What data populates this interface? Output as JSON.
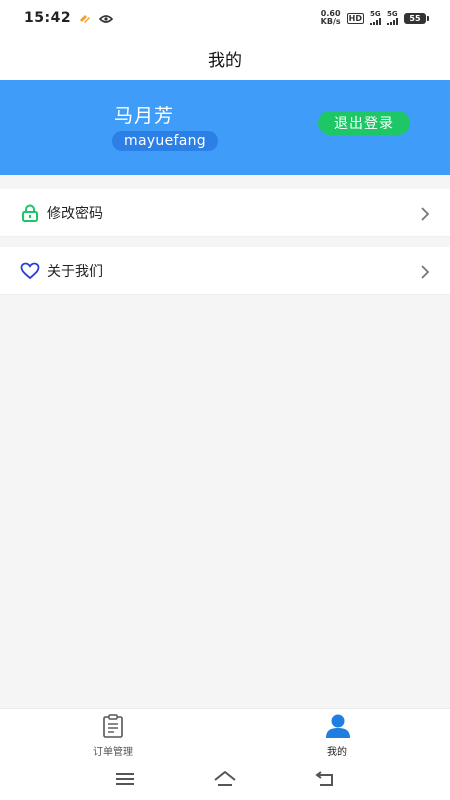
{
  "status_bar": {
    "time": "15:42",
    "net_speed_value": "0.60",
    "net_speed_unit": "KB/s",
    "hd_label": "HD",
    "signal_1_label": "5G",
    "signal_2_label": "5G",
    "battery_level": "55"
  },
  "header": {
    "title": "我的"
  },
  "profile": {
    "name": "马月芳",
    "username": "mayuefang",
    "logout_label": "退出登录"
  },
  "menu": {
    "items": [
      {
        "label": "修改密码",
        "icon": "lock-icon"
      },
      {
        "label": "关于我们",
        "icon": "heart-icon"
      }
    ]
  },
  "tab_bar": {
    "tabs": [
      {
        "label": "订单管理",
        "icon": "clipboard-icon",
        "active": false
      },
      {
        "label": "我的",
        "icon": "person-icon",
        "active": true
      }
    ]
  },
  "colors": {
    "accent_blue": "#3f9cf9",
    "logout_green": "#1ec766",
    "lock_green": "#1ec766",
    "heart_blue": "#2a3fd6",
    "tab_active_blue": "#1f7fe0"
  }
}
